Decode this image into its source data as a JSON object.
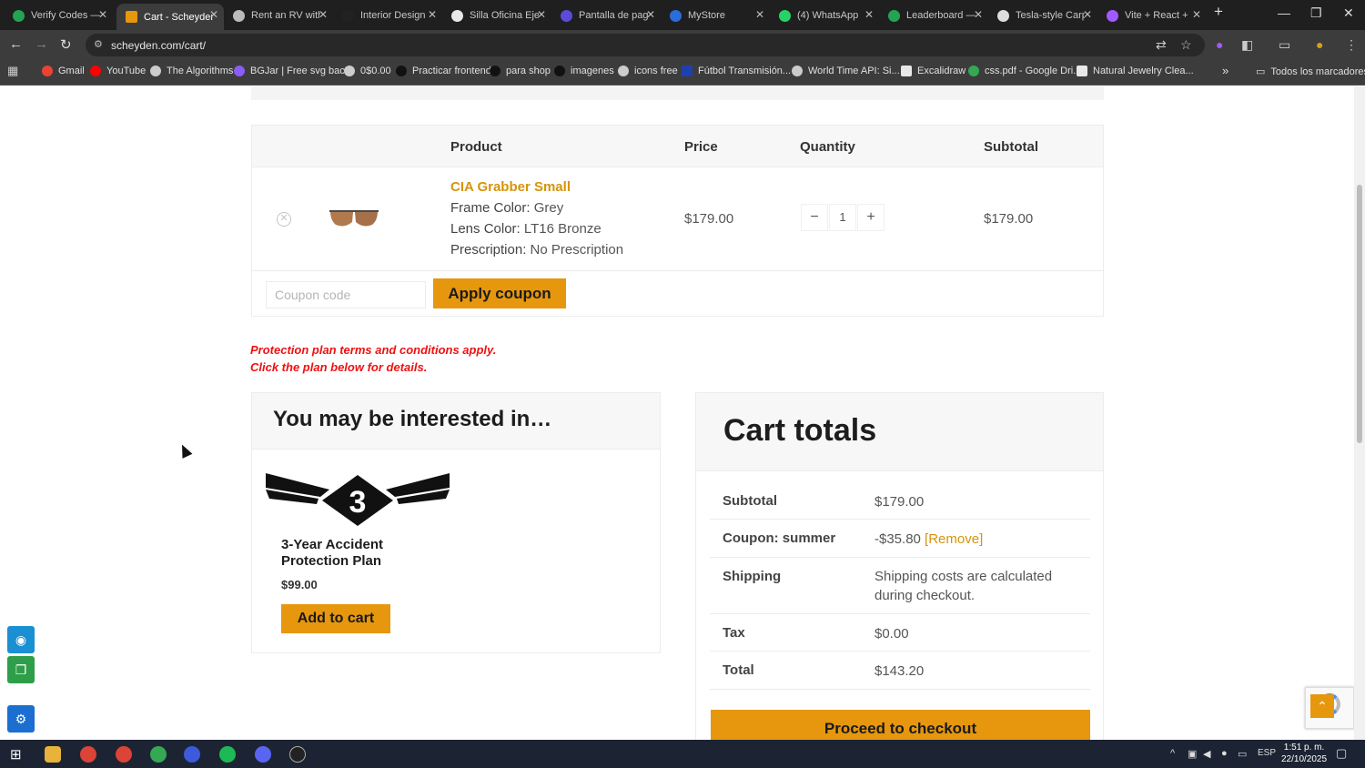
{
  "browser": {
    "tabs": [
      {
        "title": "Verify Codes —",
        "color": "#23a455",
        "active": false
      },
      {
        "title": "Cart - Scheyden",
        "color": "#e6970e",
        "active": true
      },
      {
        "title": "Rent an RV with",
        "color": "#bbbbbb",
        "active": false
      },
      {
        "title": "Interior Design",
        "color": "#222222",
        "active": false
      },
      {
        "title": "Silla Oficina Eje",
        "color": "#e8e8e8",
        "active": false
      },
      {
        "title": "Pantalla de pag",
        "color": "#5b4bdb",
        "active": false
      },
      {
        "title": "MyStore",
        "color": "#2a6edb",
        "active": false
      },
      {
        "title": "(4) WhatsApp",
        "color": "#25d366",
        "active": false
      },
      {
        "title": "Leaderboard —",
        "color": "#23a455",
        "active": false
      },
      {
        "title": "Tesla-style Carp",
        "color": "#dddddd",
        "active": false
      },
      {
        "title": "Vite + React +",
        "color": "#a259ff",
        "active": false
      }
    ],
    "url": "scheyden.com/cart/",
    "bookmarks": [
      {
        "label": "Gmail",
        "color": "#ea4335"
      },
      {
        "label": "YouTube",
        "color": "#ff0000"
      },
      {
        "label": "The Algorithms",
        "color": "#cccccc"
      },
      {
        "label": "BGJar | Free svg bac...",
        "color": "#8b5cf6"
      },
      {
        "label": "0$0.00",
        "color": "#cccccc"
      },
      {
        "label": "Practicar frontend",
        "color": "#111111"
      },
      {
        "label": "para shop",
        "color": "#111111"
      },
      {
        "label": "imagenes",
        "color": "#111111"
      },
      {
        "label": "icons free",
        "color": "#cccccc"
      },
      {
        "label": "Fútbol Transmisión...",
        "color": "#1e40af"
      },
      {
        "label": "World Time API: Si...",
        "color": "#cccccc"
      },
      {
        "label": "Excalidraw",
        "color": "#e8e8e8"
      },
      {
        "label": "css.pdf - Google Dri...",
        "color": "#34a853"
      },
      {
        "label": "Natural Jewelry Clea...",
        "color": "#e8e8e8"
      }
    ],
    "all_bookmarks": "Todos los marcadores"
  },
  "cart": {
    "headers": {
      "product": "Product",
      "price": "Price",
      "quantity": "Quantity",
      "subtotal": "Subtotal"
    },
    "item": {
      "name": "CIA Grabber Small",
      "frame_label": "Frame Color:",
      "frame_value": "Grey",
      "lens_label": "Lens Color:",
      "lens_value": "LT16 Bronze",
      "rx_label": "Prescription:",
      "rx_value": "No Prescription",
      "price": "$179.00",
      "qty": "1",
      "minus": "−",
      "plus": "+",
      "subtotal": "$179.00"
    },
    "coupon_placeholder": "Coupon code",
    "apply_label": "Apply coupon"
  },
  "notice": {
    "line1": "Protection plan terms and conditions apply.",
    "line2": "Click the plan below for details."
  },
  "upsell": {
    "title": "You may be interested in…",
    "product_name": "3-Year Accident Protection Plan",
    "price": "$99.00",
    "badge_number": "3",
    "add_label": "Add to cart"
  },
  "totals": {
    "title": "Cart totals",
    "subtotal_label": "Subtotal",
    "subtotal_value": "$179.00",
    "coupon_label": "Coupon: summer",
    "coupon_value": "-$35.80",
    "coupon_remove": "[Remove]",
    "shipping_label": "Shipping",
    "shipping_value": "Shipping costs are calculated during checkout.",
    "tax_label": "Tax",
    "tax_value": "$0.00",
    "total_label": "Total",
    "total_value": "$143.20",
    "checkout_label": "Proceed to checkout"
  },
  "taskbar": {
    "lang": "ESP",
    "time": "1:51 p. m.",
    "date": "22/10/2025"
  },
  "colors": {
    "accent": "#e6970e",
    "notice": "#ee1111",
    "link": "#d69409"
  }
}
